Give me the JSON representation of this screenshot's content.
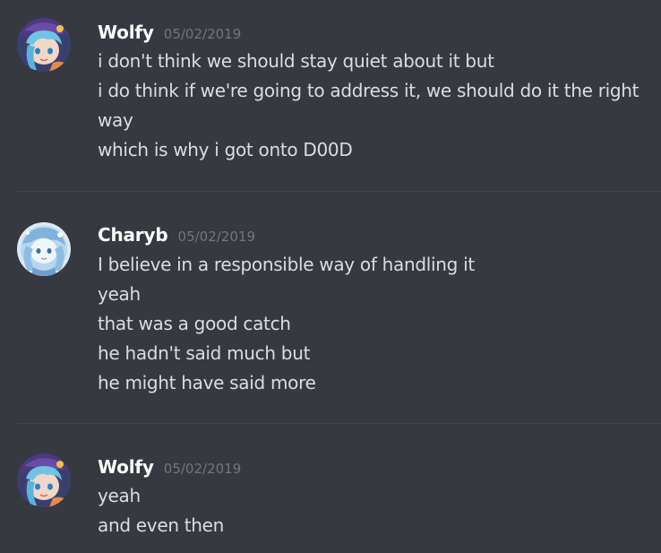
{
  "messages": [
    {
      "author": "Wolfy",
      "timestamp": "05/02/2019",
      "lines": [
        "i don't think we should stay quiet about it but",
        "i do think if we're going to address it, we should do it the right",
        "way",
        "which is why i got onto D00D"
      ]
    },
    {
      "author": "Charyb",
      "timestamp": "05/02/2019",
      "lines": [
        "I believe in a responsible way of handling it",
        "yeah",
        "that was a good catch",
        "he hadn't said much but",
        "he might have said more"
      ]
    },
    {
      "author": "Wolfy",
      "timestamp": "05/02/2019",
      "lines": [
        "yeah",
        "and even then"
      ]
    }
  ],
  "colors": {
    "background": "#36393f",
    "username": "#ffffff",
    "text": "#dcddde",
    "timestamp": "#72767d",
    "divider": "#42454a"
  }
}
